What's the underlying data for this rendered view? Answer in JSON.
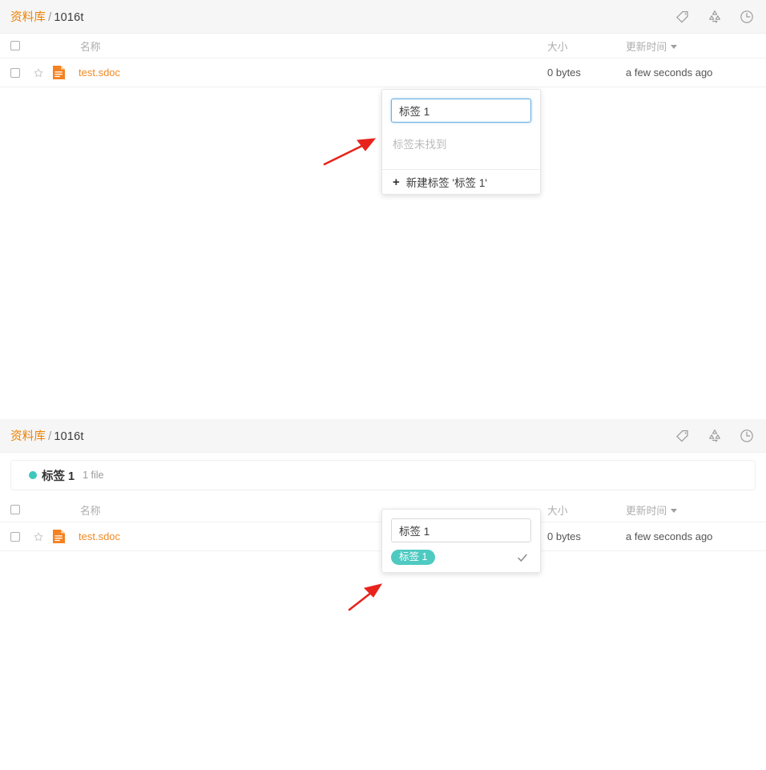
{
  "panels": [
    {
      "header": {
        "breadcrumb_root": "资料库",
        "breadcrumb_sep": "/",
        "breadcrumb_current": "1016t",
        "icons": [
          "tag-icon",
          "recycle-bin-icon",
          "history-clock-icon"
        ]
      },
      "table": {
        "columns": {
          "name": "名称",
          "size": "大小",
          "time": "更新时间"
        },
        "rows": [
          {
            "name": "test.sdoc",
            "size": "0 bytes",
            "time": "a few seconds ago",
            "file_icon": "sdoc-document-icon"
          }
        ]
      },
      "popup": {
        "input_value": "标签 1",
        "input_placeholder": "",
        "empty_text": "标签未找到",
        "create_label": "新建标签 '标签 1'",
        "create_plus": "+"
      }
    },
    {
      "header": {
        "breadcrumb_root": "资料库",
        "breadcrumb_sep": "/",
        "breadcrumb_current": "1016t",
        "icons": [
          "tag-icon",
          "recycle-bin-icon",
          "history-clock-icon"
        ]
      },
      "tag_banner": {
        "tag_name": "标签 1",
        "file_count": "1 file",
        "dot_color": "#3fc6bd"
      },
      "table": {
        "columns": {
          "name": "名称",
          "size": "大小",
          "time": "更新时间"
        },
        "rows": [
          {
            "name": "test.sdoc",
            "size": "0 bytes",
            "time": "a few seconds ago",
            "file_icon": "sdoc-document-icon"
          }
        ]
      },
      "popup": {
        "input_value": "标签 1",
        "input_placeholder": "",
        "option_pill": "标签 1",
        "option_selected_icon": "check-icon",
        "pill_color": "#4ecac1"
      }
    }
  ],
  "annotations": {
    "arrow_color": "#e8231c",
    "arrow_1": "points-to-tag-input",
    "arrow_2": "points-to-tag-option"
  },
  "colors": {
    "accent_orange": "#f08a24",
    "link_orange": "#eb8205",
    "teal": "#4ecac1",
    "focus_blue": "#6aaee0",
    "header_bg": "#f6f6f6"
  }
}
